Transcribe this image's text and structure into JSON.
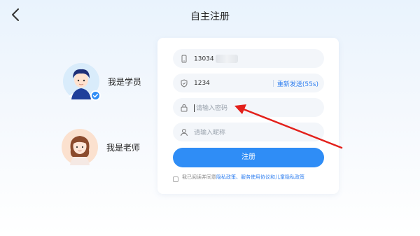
{
  "header": {
    "title": "自主注册"
  },
  "roles": [
    {
      "label": "我是学员",
      "selected": true
    },
    {
      "label": "我是老师",
      "selected": false
    }
  ],
  "form": {
    "phone": {
      "value": "13034"
    },
    "code": {
      "value": "1234",
      "send_label": "重新发送(55s)"
    },
    "password": {
      "placeholder": "请输入密码"
    },
    "nickname": {
      "placeholder": "请输入昵称"
    },
    "submit_label": "注册",
    "agreement": {
      "prefix": "我已阅读并同意",
      "privacy": "隐私政策",
      "sep1": "、",
      "service": "服务使用协议",
      "sep2": "和",
      "child": "儿童隐私政策"
    }
  },
  "colors": {
    "accent": "#2f8df6",
    "annotation": "#e3201b"
  }
}
